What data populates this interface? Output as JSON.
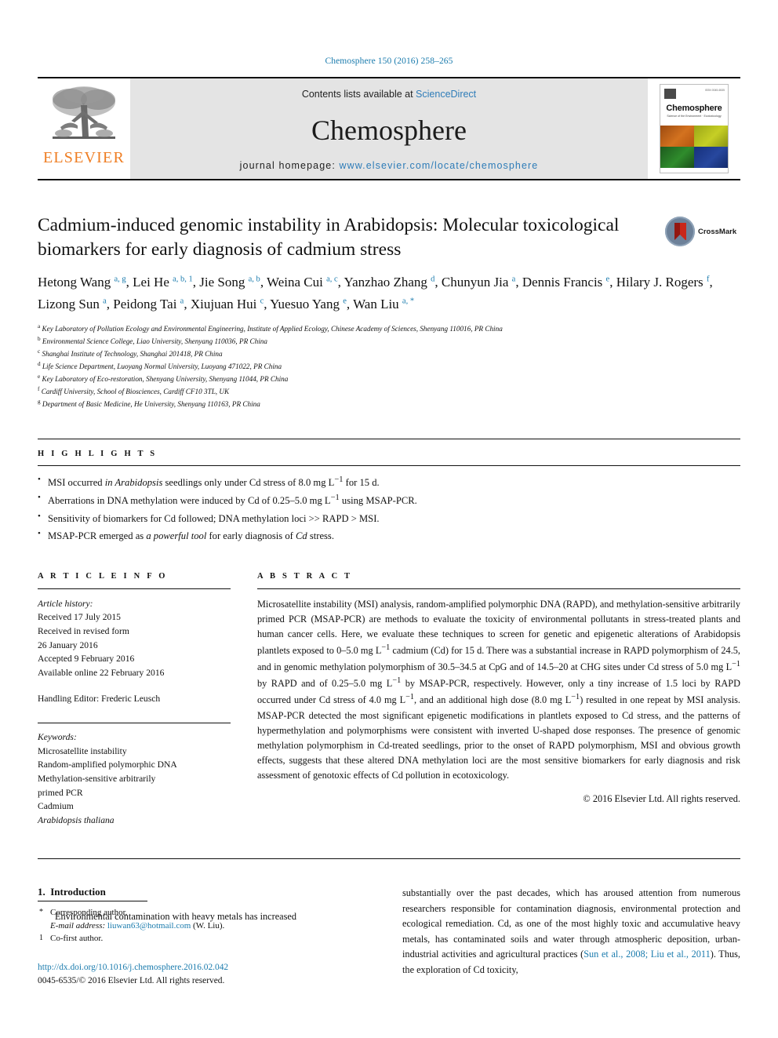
{
  "running_head": "Chemosphere 150 (2016) 258–265",
  "masthead": {
    "publisher_wordmark": "ELSEVIER",
    "contents_prefix": "Contents lists available at ",
    "contents_link": "ScienceDirect",
    "journal_name": "Chemosphere",
    "homepage_prefix": "journal homepage: ",
    "homepage_url": "www.elsevier.com/locate/chemosphere",
    "cover": {
      "title": "Chemosphere",
      "subtitle": "Science of the Environment · Ecotoxicology",
      "issn_note": "ISSN 0045-6535"
    }
  },
  "article": {
    "title": "Cadmium-induced genomic instability in Arabidopsis: Molecular toxicological biomarkers for early diagnosis of cadmium stress",
    "crossmark_label": "CrossMark",
    "authors_html": "Hetong Wang <sup>a, g</sup>, Lei He <sup>a, b, 1</sup>, Jie Song <sup>a, b</sup>, Weina Cui <sup>a, c</sup>, Yanzhao Zhang <sup>d</sup>, Chunyun Jia <sup>a</sup>, Dennis Francis <sup>e</sup>, Hilary J. Rogers <sup>f</sup>, Lizong Sun <sup>a</sup>, Peidong Tai <sup>a</sup>, Xiujuan Hui <sup>c</sup>, Yuesuo Yang <sup>e</sup>, Wan Liu <sup>a, *</sup>",
    "affiliations": [
      {
        "mark": "a",
        "text": "Key Laboratory of Pollution Ecology and Environmental Engineering, Institute of Applied Ecology, Chinese Academy of Sciences, Shenyang 110016, PR China"
      },
      {
        "mark": "b",
        "text": "Environmental Science College, Liao University, Shenyang 110036, PR China"
      },
      {
        "mark": "c",
        "text": "Shanghai Institute of Technology, Shanghai 201418, PR China"
      },
      {
        "mark": "d",
        "text": "Life Science Department, Luoyang Normal University, Luoyang 471022, PR China"
      },
      {
        "mark": "e",
        "text": "Key Laboratory of Eco-restoration, Shenyang University, Shenyang 11044, PR China"
      },
      {
        "mark": "f",
        "text": "Cardiff University, School of Biosciences, Cardiff CF10 3TL, UK"
      },
      {
        "mark": "g",
        "text": "Department of Basic Medicine, He University, Shenyang 110163, PR China"
      }
    ]
  },
  "highlights": {
    "heading": "H I G H L I G H T S",
    "items_html": [
      "MSI occurred <i>in Arabidopsis</i> seedlings only under Cd stress of 8.0 mg L<sup>&minus;1</sup> for 15 d.",
      "Aberrations in DNA methylation were induced by Cd of 0.25&ndash;5.0 mg L<sup>&minus;1</sup> using MSAP-PCR.",
      "Sensitivity of biomarkers for Cd followed; DNA methylation loci &gt;&gt; RAPD &gt; MSI.",
      "MSAP-PCR emerged as <i>a powerful tool</i> for early diagnosis of <i>Cd</i> stress."
    ]
  },
  "article_info": {
    "heading": "A R T I C L E   I N F O",
    "history_label": "Article history:",
    "history_lines": [
      "Received 17 July 2015",
      "Received in revised form",
      "26 January 2016",
      "Accepted 9 February 2016",
      "Available online 22 February 2016"
    ],
    "handling_editor": "Handling Editor: Frederic Leusch",
    "keywords_label": "Keywords:",
    "keywords": [
      "Microsatellite instability",
      "Random-amplified polymorphic DNA",
      "Methylation-sensitive arbitrarily",
      "primed PCR",
      "Cadmium"
    ],
    "keyword_italic": "Arabidopsis thaliana"
  },
  "abstract": {
    "heading": "A B S T R A C T",
    "text_html": "Microsatellite instability (MSI) analysis, random-amplified polymorphic DNA (RAPD), and methylation-sensitive arbitrarily primed PCR (MSAP-PCR) are methods to evaluate the toxicity of environmental pollutants in stress-treated plants and human cancer cells. Here, we evaluate these techniques to screen for genetic and epigenetic alterations of Arabidopsis plantlets exposed to 0&ndash;5.0 mg L<sup>&minus;1</sup> cadmium (Cd) for 15 d. There was a substantial increase in RAPD polymorphism of 24.5, and in genomic methylation polymorphism of 30.5&ndash;34.5 at CpG and of 14.5&ndash;20 at CHG sites under Cd stress of 5.0 mg L<sup>&minus;1</sup> by RAPD and of 0.25&ndash;5.0 mg L<sup>&minus;1</sup> by MSAP-PCR, respectively. However, only a tiny increase of 1.5 loci by RAPD occurred under Cd stress of 4.0 mg L<sup>&minus;1</sup>, and an additional high dose (8.0 mg L<sup>&minus;1</sup>) resulted in one repeat by MSI analysis. MSAP-PCR detected the most significant epigenetic modifications in plantlets exposed to Cd stress, and the patterns of hypermethylation and polymorphisms were consistent with inverted U-shaped dose responses. The presence of genomic methylation polymorphism in Cd-treated seedlings, prior to the onset of RAPD polymorphism, MSI and obvious growth effects, suggests that these altered DNA methylation loci are the most sensitive biomarkers for early diagnosis and risk assessment of genotoxic effects of Cd pollution in ecotoxicology.",
    "copyright": "© 2016 Elsevier Ltd. All rights reserved."
  },
  "body": {
    "section_number": "1.",
    "section_title": "Introduction",
    "left_paragraph": "Environmental contamination with heavy metals has increased",
    "right_paragraph_html": "substantially over the past decades, which has aroused attention from numerous researchers responsible for contamination diagnosis, environmental protection and ecological remediation. Cd, as one of the most highly toxic and accumulative heavy metals, has contaminated soils and water through atmospheric deposition, urban-industrial activities and agricultural practices (<span class=\"lnk\">Sun et al., 2008; Liu et al., 2011</span>). Thus, the exploration of Cd toxicity,"
  },
  "footnotes": {
    "corresponding_mark": "*",
    "corresponding_text": "Corresponding author.",
    "email_label": "E-mail address:",
    "email": "liuwan63@hotmail.com",
    "email_owner": "(W. Liu).",
    "cofirst_mark": "1",
    "cofirst_text": "Co-first author.",
    "doi": "http://dx.doi.org/10.1016/j.chemosphere.2016.02.042",
    "issn_line": "0045-6535/© 2016 Elsevier Ltd. All rights reserved."
  },
  "colors": {
    "link_blue": "#1a7bad",
    "elsevier_orange": "#ef7d22",
    "banner_gray": "#e4e4e4"
  }
}
